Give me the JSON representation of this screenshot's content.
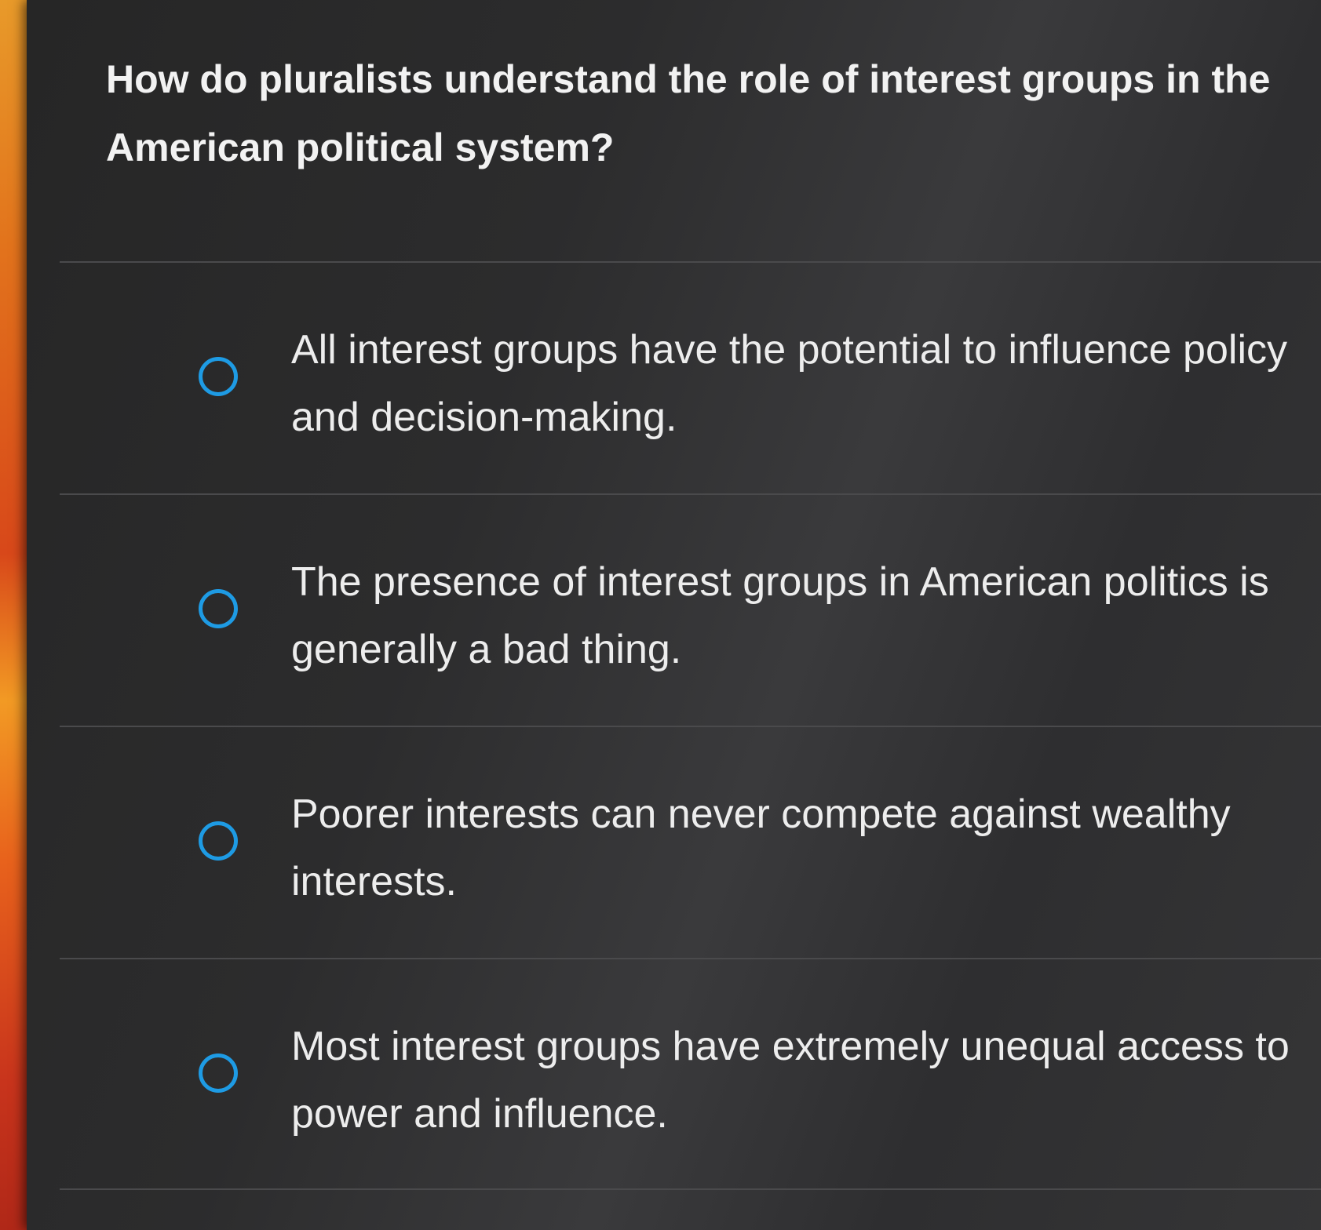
{
  "question": {
    "text": "How do pluralists understand the role of interest groups in the American political system?"
  },
  "options": [
    {
      "label": "All interest groups have the potential to influence policy and decision-making.",
      "selected": false
    },
    {
      "label": "The presence of interest groups in American politics is generally a bad thing.",
      "selected": false
    },
    {
      "label": "Poorer interests can never compete against wealthy interests.",
      "selected": false
    },
    {
      "label": "Most interest groups have extremely unequal access to power and influence.",
      "selected": false
    }
  ],
  "colors": {
    "radio_accent": "#1e9be4",
    "text": "#ededed",
    "background": "#2c2c2d"
  }
}
